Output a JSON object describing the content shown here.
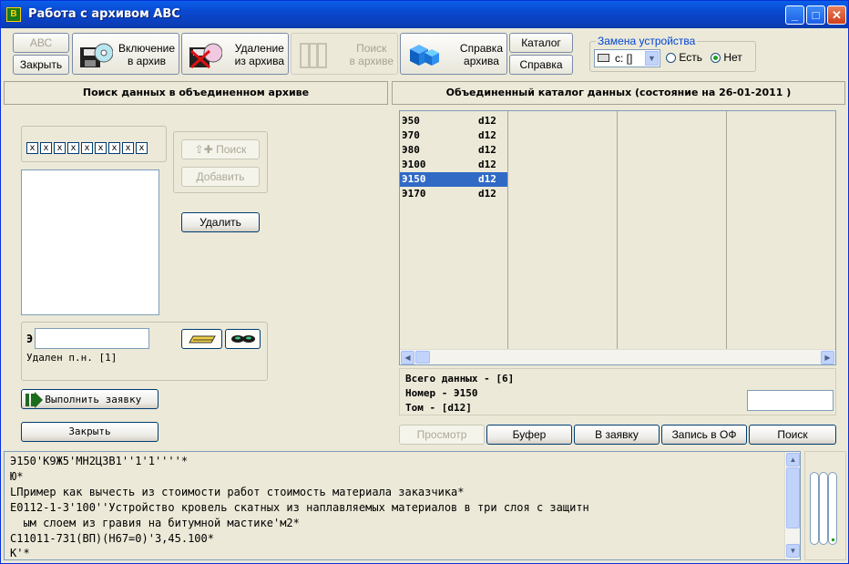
{
  "window": {
    "title": "Работа с архивом АВС",
    "minimize": "_",
    "maximize": "□",
    "close": "✕"
  },
  "toolbar": {
    "abc_label": "АВС",
    "close_label": "Закрыть",
    "include": [
      "Включение",
      "в архив"
    ],
    "remove": [
      "Удаление",
      "из архива"
    ],
    "search": [
      "Поиск",
      "в архиве"
    ],
    "help_archive": [
      "Справка",
      "архива"
    ],
    "catalog_label": "Каталог",
    "help_label": "Справка",
    "device_group_title": "Замена устройства",
    "drive_value": "c: []",
    "radio_yes": "Есть",
    "radio_no": "Нет",
    "radio_selected": "Нет"
  },
  "left_panel": {
    "header": "Поиск данных в объединенном архиве",
    "xboxes": [
      "x",
      "x",
      "x",
      "x",
      "x",
      "x",
      "x",
      "x",
      "x"
    ],
    "search_button": "Поиск",
    "add_button": "Добавить",
    "delete_button": "Удалить",
    "e_prefix": "Э",
    "e_input_value": "",
    "deleted_text": "Удален п.н. [1]",
    "execute_button": "Выполнить заявку",
    "close_button": "Закрыть"
  },
  "right_panel": {
    "header": "Объединенный каталог данных (состояние на 26-01-2011 )",
    "rows": [
      {
        "name": "Э50",
        "vol": "d12",
        "selected": false
      },
      {
        "name": "Э70",
        "vol": "d12",
        "selected": false
      },
      {
        "name": "Э80",
        "vol": "d12",
        "selected": false
      },
      {
        "name": "Э100",
        "vol": "d12",
        "selected": false
      },
      {
        "name": "Э150",
        "vol": "d12",
        "selected": true
      },
      {
        "name": "Э170",
        "vol": "d12",
        "selected": false
      }
    ],
    "info": {
      "total": "Всего данных - [6]",
      "number": "Номер - Э150",
      "volume": "Том - [d12]"
    },
    "info_input_value": "",
    "buttons": {
      "view": "Просмотр",
      "buffer": "Буфер",
      "to_request": "В заявку",
      "write_of": "Запись в ОФ",
      "search": "Поиск"
    }
  },
  "editor": {
    "lines": [
      "Э150'К9Ж5'МН2Ц3В1''1'1''''*",
      "Ю*",
      "LПример как вычесть из стоимости работ стоимость материала заказчика*",
      "Е0112-1-3'100''Устройство кровель скатных из наплавляемых материалов в три слоя с защитн",
      "  ым слоем из гравия на битумной мастике'м2*",
      "С11011-731(ВП)(Н67=0)'3,45.100*",
      "К'*"
    ]
  },
  "colors": {
    "title_bar": "#0a48d0",
    "selection": "#316ac5",
    "window_bg": "#ece9d8",
    "group_title": "#0046d5"
  }
}
